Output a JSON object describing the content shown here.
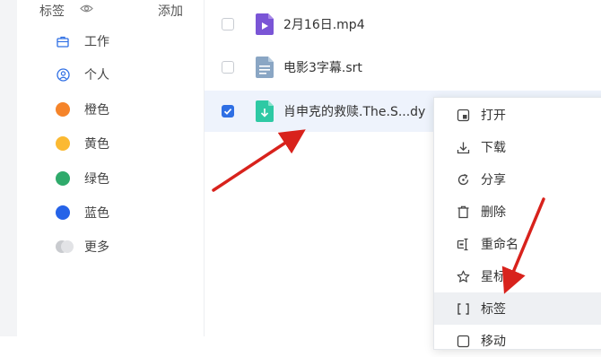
{
  "sidebar": {
    "header": "标签",
    "add_label": "添加",
    "items": [
      {
        "label": "工作",
        "icon": "briefcase-icon"
      },
      {
        "label": "个人",
        "icon": "person-icon"
      },
      {
        "label": "橙色",
        "color": "#f5842a"
      },
      {
        "label": "黄色",
        "color": "#fbb932"
      },
      {
        "label": "绿色",
        "color": "#2faa6b"
      },
      {
        "label": "蓝色",
        "color": "#2563e8"
      },
      {
        "label": "更多",
        "icon": "more-colors-icon"
      }
    ]
  },
  "files": [
    {
      "name": "2月16日.mp4",
      "checked": false,
      "icon": "video-file-icon",
      "color": "#7a55d6"
    },
    {
      "name": "电影3字幕.srt",
      "checked": false,
      "icon": "text-file-icon",
      "color": "#8aa6c4"
    },
    {
      "name": "肖申克的救赎.The.S...dy",
      "checked": true,
      "icon": "download-file-icon",
      "color": "#2ec9a4"
    }
  ],
  "context_menu": {
    "items": [
      {
        "label": "打开",
        "icon": "open-icon"
      },
      {
        "label": "下载",
        "icon": "download-icon"
      },
      {
        "label": "分享",
        "icon": "share-icon"
      },
      {
        "label": "删除",
        "icon": "trash-icon"
      },
      {
        "label": "重命名",
        "icon": "rename-icon"
      },
      {
        "label": "星标",
        "icon": "star-icon"
      },
      {
        "label": "标签",
        "icon": "tag-bracket-icon"
      },
      {
        "label": "移动",
        "icon": "move-icon"
      }
    ],
    "highlighted_index": 6
  },
  "colors": {
    "accent": "#2f6fe4",
    "arrow": "#d8221c",
    "selected_row": "#eef3fc"
  }
}
